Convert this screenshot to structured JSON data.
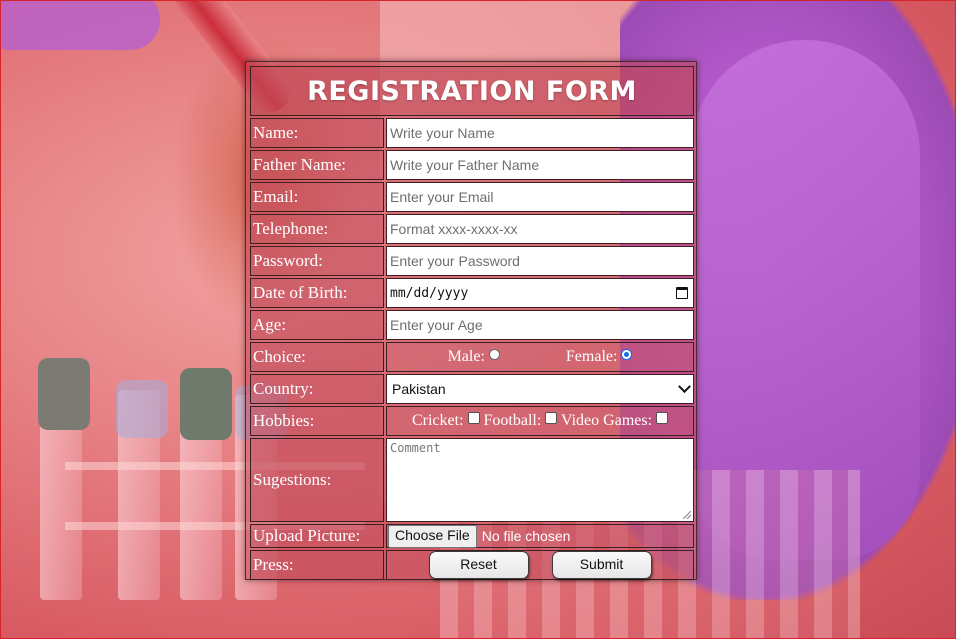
{
  "form": {
    "title": "REGISTRATION FORM",
    "name": {
      "label": "Name:",
      "placeholder": "Write your Name"
    },
    "father_name": {
      "label": "Father Name:",
      "placeholder": "Write your Father Name"
    },
    "email": {
      "label": "Email:",
      "placeholder": "Enter your Email"
    },
    "telephone": {
      "label": "Telephone:",
      "placeholder": "Format xxxx-xxxx-xx"
    },
    "password": {
      "label": "Password:",
      "placeholder": "Enter your Password"
    },
    "dob": {
      "label": "Date of Birth:",
      "value": "mm/dd/yyyy"
    },
    "age": {
      "label": "Age:",
      "placeholder": "Enter your Age"
    },
    "choice": {
      "label": "Choice:",
      "options": [
        {
          "label": "Male:",
          "checked": false
        },
        {
          "label": "Female:",
          "checked": true
        }
      ]
    },
    "country": {
      "label": "Country:",
      "selected": "Pakistan"
    },
    "hobbies": {
      "label": "Hobbies:",
      "options": [
        {
          "label": "Cricket:",
          "checked": false
        },
        {
          "label": "Football:",
          "checked": false
        },
        {
          "label": "Video Games:",
          "checked": false
        }
      ]
    },
    "suggestions": {
      "label": "Sugestions:",
      "placeholder": "Comment"
    },
    "upload": {
      "label": "Upload Picture:",
      "button": "Choose File",
      "status": "No file chosen"
    },
    "press": {
      "label": "Press:",
      "reset": "Reset",
      "submit": "Submit"
    }
  },
  "colors": {
    "accent_radio": "#1a6fe8",
    "frame_border": "#d4242c"
  }
}
